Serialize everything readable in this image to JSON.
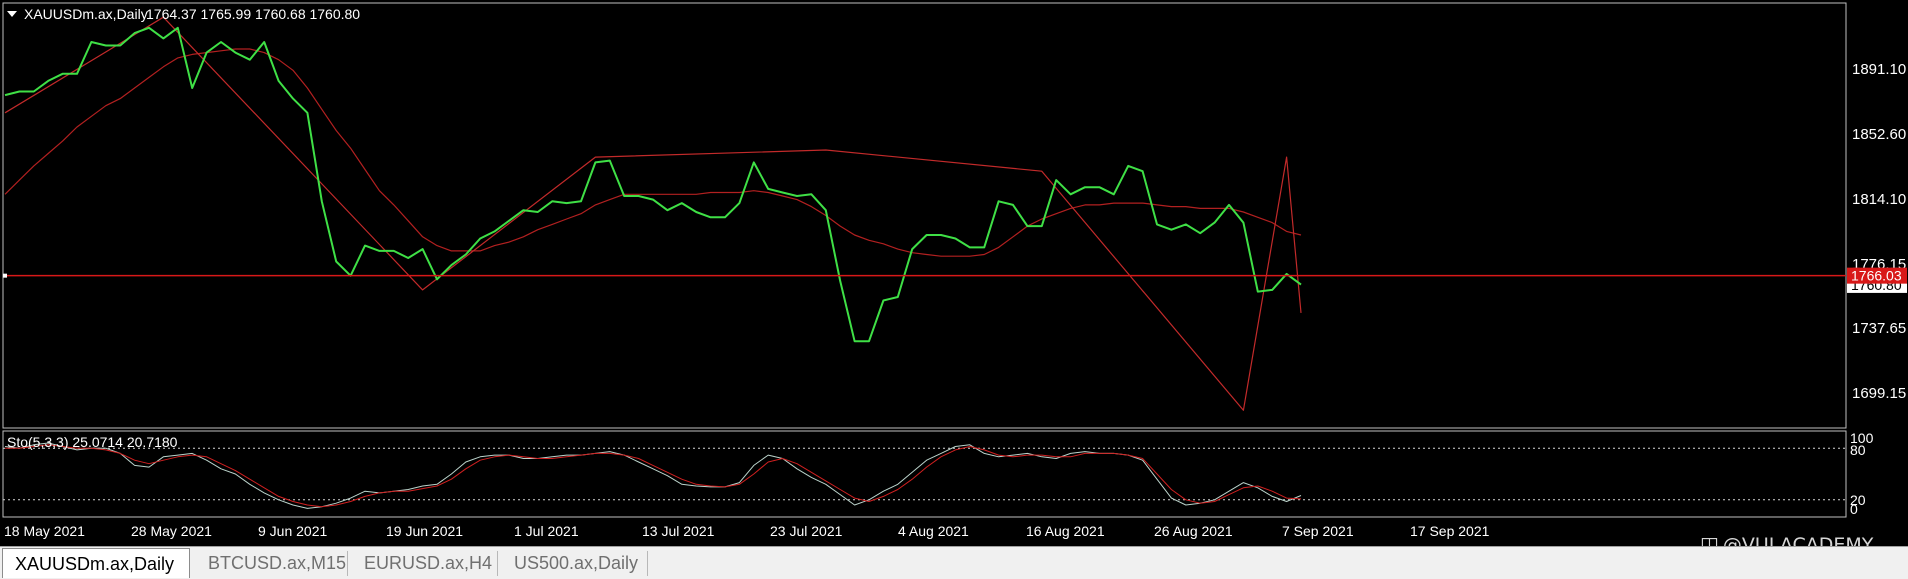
{
  "main_chart": {
    "header": {
      "symbol_label": "XAUUSDm.ax,Daily",
      "ohlc_text": "1764.37 1765.99 1760.68 1760.80",
      "menu_icon": "triangle-down-icon"
    },
    "price_labels": [
      "1891.10",
      "1852.60",
      "1814.10",
      "1776.15",
      "1737.65",
      "1699.15"
    ],
    "current_price_tag": "1766.03",
    "last_price_tag": "1760.80"
  },
  "indicator": {
    "label": "Sto(5,3,3) 25.0714 20.7180",
    "levels": [
      "100",
      "80",
      "20",
      "0"
    ]
  },
  "time_labels": [
    "18 May 2021",
    "28 May 2021",
    "9 Jun 2021",
    "19 Jun 2021",
    "1 Jul 2021",
    "13 Jul 2021",
    "23 Jul 2021",
    "4 Aug 2021",
    "16 Aug 2021",
    "26 Aug 2021",
    "7 Sep 2021",
    "17 Sep 2021"
  ],
  "tabs": [
    {
      "label": "XAUUSDm.ax,Daily",
      "active": true
    },
    {
      "label": "BTCUSD.ax,M15",
      "active": false
    },
    {
      "label": "EURUSD.ax,H4",
      "active": false
    },
    {
      "label": "US500.ax,Daily",
      "active": false
    }
  ],
  "watermark": {
    "text": "@VULACADEMY",
    "icon": "camera-icon"
  },
  "colors": {
    "background": "#000000",
    "price_line": "#3fe046",
    "moving_average": "#b22020",
    "zigzag": "#c22a2a",
    "current_price": "#d81818",
    "stoch_main": "#bcd4cc",
    "stoch_signal": "#d02020",
    "grid_frame": "#c0c0c0"
  },
  "chart_data": [
    {
      "type": "line",
      "title": "",
      "xlabel": "",
      "ylabel": "",
      "x": [
        "17 May 2021",
        "18 May 2021",
        "19 May 2021",
        "20 May 2021",
        "21 May 2021",
        "24 May 2021",
        "25 May 2021",
        "26 May 2021",
        "27 May 2021",
        "28 May 2021",
        "31 May 2021",
        "1 Jun 2021",
        "2 Jun 2021",
        "3 Jun 2021",
        "4 Jun 2021",
        "7 Jun 2021",
        "8 Jun 2021",
        "9 Jun 2021",
        "10 Jun 2021",
        "11 Jun 2021",
        "14 Jun 2021",
        "15 Jun 2021",
        "16 Jun 2021",
        "17 Jun 2021",
        "18 Jun 2021",
        "21 Jun 2021",
        "22 Jun 2021",
        "23 Jun 2021",
        "24 Jun 2021",
        "25 Jun 2021",
        "28 Jun 2021",
        "29 Jun 2021",
        "30 Jun 2021",
        "1 Jul 2021",
        "2 Jul 2021",
        "5 Jul 2021",
        "6 Jul 2021",
        "7 Jul 2021",
        "8 Jul 2021",
        "9 Jul 2021",
        "12 Jul 2021",
        "13 Jul 2021",
        "14 Jul 2021",
        "15 Jul 2021",
        "16 Jul 2021",
        "19 Jul 2021",
        "20 Jul 2021",
        "21 Jul 2021",
        "22 Jul 2021",
        "23 Jul 2021",
        "26 Jul 2021",
        "27 Jul 2021",
        "28 Jul 2021",
        "29 Jul 2021",
        "30 Jul 2021",
        "2 Aug 2021",
        "3 Aug 2021",
        "4 Aug 2021",
        "5 Aug 2021",
        "6 Aug 2021",
        "9 Aug 2021",
        "10 Aug 2021",
        "11 Aug 2021",
        "12 Aug 2021",
        "13 Aug 2021",
        "16 Aug 2021",
        "17 Aug 2021",
        "18 Aug 2021",
        "19 Aug 2021",
        "20 Aug 2021",
        "23 Aug 2021",
        "24 Aug 2021",
        "25 Aug 2021",
        "26 Aug 2021",
        "27 Aug 2021",
        "30 Aug 2021",
        "31 Aug 2021",
        "1 Sep 2021",
        "2 Sep 2021",
        "3 Sep 2021",
        "6 Sep 2021",
        "7 Sep 2021",
        "8 Sep 2021",
        "9 Sep 2021",
        "10 Sep 2021",
        "13 Sep 2021",
        "14 Sep 2021",
        "15 Sep 2021",
        "16 Sep 2021",
        "17 Sep 2021",
        "20 Sep 2021"
      ],
      "ylim": [
        1680,
        1920
      ],
      "series": [
        {
          "values": [
            1868,
            1870,
            1870,
            1876,
            1880,
            1880,
            1898,
            1896,
            1896,
            1903,
            1906,
            1900,
            1906,
            1872,
            1892,
            1898,
            1892,
            1888,
            1898,
            1876,
            1866,
            1858,
            1808,
            1774,
            1766,
            1783,
            1780,
            1780,
            1776,
            1781,
            1764,
            1772,
            1778,
            1787,
            1791,
            1797,
            1803,
            1802,
            1808,
            1807,
            1808,
            1830,
            1831,
            1811,
            1811,
            1809,
            1803,
            1807,
            1802,
            1799,
            1799,
            1807,
            1830,
            1815,
            1813,
            1811,
            1812,
            1803,
            1763,
            1729,
            1729,
            1752,
            1754,
            1781,
            1789,
            1789,
            1787,
            1782,
            1782,
            1808,
            1806,
            1794,
            1794,
            1820,
            1812,
            1816,
            1816,
            1812,
            1828,
            1825,
            1795,
            1792,
            1795,
            1790,
            1796,
            1806,
            1796,
            1757,
            1758,
            1767,
            1761
          ]
        },
        {
          "values": [
            1812,
            1820,
            1828,
            1835,
            1842,
            1850,
            1856,
            1862,
            1866,
            1872,
            1878,
            1884,
            1889,
            1891,
            1892,
            1893,
            1894,
            1894,
            1892,
            1888,
            1882,
            1872,
            1860,
            1848,
            1838,
            1826,
            1814,
            1806,
            1797,
            1788,
            1783,
            1780,
            1780,
            1780,
            1783,
            1785,
            1788,
            1792,
            1795,
            1798,
            1801,
            1806,
            1809,
            1812,
            1812,
            1812,
            1812,
            1812,
            1812,
            1813,
            1813,
            1813,
            1814,
            1813,
            1811,
            1809,
            1805,
            1800,
            1794,
            1789,
            1786,
            1784,
            1781,
            1779,
            1778,
            1777,
            1777,
            1777,
            1778,
            1782,
            1788,
            1794,
            1798,
            1801,
            1804,
            1806,
            1806,
            1807,
            1807,
            1807,
            1806,
            1805,
            1805,
            1804,
            1804,
            1804,
            1802,
            1799,
            1796,
            1791,
            1789
          ]
        },
        {
          "values": [
            1858,
            1912,
            1758,
            1833,
            1837,
            1825,
            1690,
            1833,
            1745
          ]
        }
      ],
      "annotations": [
        "zigzag swing line",
        "current price line 1766.03"
      ]
    },
    {
      "type": "line",
      "title": "Sto(5,3,3) 25.0714 20.7180",
      "ylim": [
        0,
        100
      ],
      "levels": [
        80,
        20
      ],
      "series": [
        {
          "values": [
            82,
            80,
            84,
            86,
            82,
            78,
            80,
            80,
            74,
            60,
            58,
            70,
            72,
            74,
            66,
            56,
            50,
            38,
            28,
            20,
            14,
            10,
            12,
            16,
            22,
            30,
            28,
            30,
            32,
            36,
            38,
            50,
            64,
            70,
            72,
            72,
            68,
            68,
            70,
            72,
            72,
            74,
            76,
            72,
            64,
            56,
            48,
            38,
            36,
            35,
            35,
            40,
            60,
            72,
            68,
            56,
            46,
            38,
            26,
            14,
            20,
            30,
            38,
            52,
            66,
            74,
            82,
            84,
            74,
            70,
            72,
            74,
            70,
            68,
            74,
            76,
            74,
            74,
            72,
            66,
            44,
            22,
            14,
            16,
            20,
            30,
            40,
            34,
            24,
            18,
            25
          ]
        },
        {
          "values": [
            80,
            80,
            82,
            84,
            82,
            80,
            80,
            78,
            74,
            66,
            62,
            66,
            70,
            72,
            70,
            62,
            54,
            44,
            34,
            24,
            18,
            14,
            12,
            14,
            18,
            24,
            28,
            30,
            30,
            33,
            36,
            44,
            56,
            66,
            70,
            72,
            70,
            68,
            68,
            70,
            72,
            74,
            74,
            72,
            68,
            60,
            52,
            44,
            38,
            36,
            35,
            38,
            50,
            64,
            68,
            62,
            52,
            42,
            32,
            22,
            18,
            24,
            32,
            44,
            58,
            70,
            78,
            82,
            78,
            72,
            70,
            72,
            72,
            70,
            70,
            74,
            74,
            74,
            72,
            68,
            50,
            32,
            20,
            16,
            18,
            26,
            34,
            36,
            30,
            22,
            21
          ]
        }
      ]
    }
  ]
}
